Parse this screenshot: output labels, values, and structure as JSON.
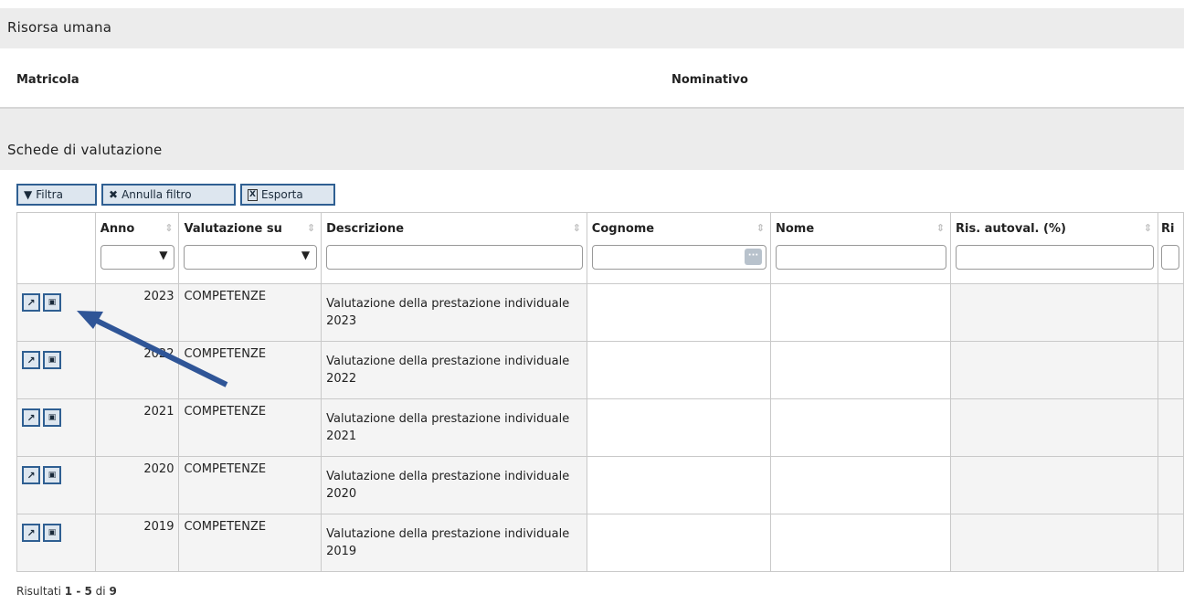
{
  "sections": {
    "risorsa_title": "Risorsa umana",
    "matricola_label": "Matricola",
    "nominativo_label": "Nominativo",
    "schede_title": "Schede di valutazione"
  },
  "toolbar": {
    "filtra_label": "Filtra",
    "filtra_icon": "filter-icon",
    "annulla_label": "Annulla filtro",
    "annulla_icon": "x-icon",
    "esporta_label": "Esporta",
    "esporta_icon": "excel-icon"
  },
  "table": {
    "columns": [
      "Anno",
      "Valutazione su",
      "Descrizione",
      "Cognome",
      "Nome",
      "Ris. autoval. (%)",
      "Ri"
    ],
    "rows": [
      {
        "anno": "2023",
        "valutazione": "COMPETENZE",
        "descrizione": "Valutazione della prestazione individuale 2023"
      },
      {
        "anno": "2022",
        "valutazione": "COMPETENZE",
        "descrizione": "Valutazione della prestazione individuale 2022"
      },
      {
        "anno": "2021",
        "valutazione": "COMPETENZE",
        "descrizione": "Valutazione della prestazione individuale 2021"
      },
      {
        "anno": "2020",
        "valutazione": "COMPETENZE",
        "descrizione": "Valutazione della prestazione individuale 2020"
      },
      {
        "anno": "2019",
        "valutazione": "COMPETENZE",
        "descrizione": "Valutazione della prestazione individuale 2019"
      }
    ],
    "row_icons": [
      "open-external-icon",
      "pdf-icon"
    ]
  },
  "footer": {
    "prefix": "Risultati",
    "range": "1 - 5",
    "of": "di",
    "total": "9"
  },
  "colors": {
    "accent": "#2f5f92",
    "annotation_arrow": "#2f5597"
  }
}
